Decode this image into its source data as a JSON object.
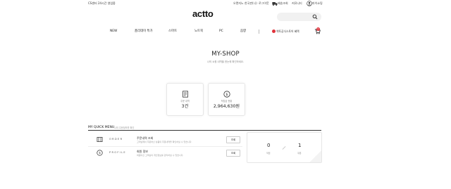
{
  "topbar": {
    "hours_text": "CS센터 24시간 영업중",
    "links": [
      "오렌지노 한국판(나)",
      "로그아웃"
    ],
    "shipping_label": "배송조회",
    "community_label": "커뮤니티",
    "mypage_label": "마이쇼핑"
  },
  "logo": "actto",
  "search": {
    "placeholder": ""
  },
  "nav": {
    "items": [
      "NEW",
      "홈리데이 특가",
      "스마트",
      "노트북",
      "PC",
      "음향"
    ],
    "promo_label": "액토공식스토어 혜택",
    "cart_count": "0"
  },
  "page": {
    "title": "MY-SHOP",
    "subtitle": "나의 쇼핑 내역을 한눈에 확인하세요."
  },
  "cards": [
    {
      "icon": "receipt-icon",
      "label": "주문 내역",
      "value": "3건"
    },
    {
      "icon": "coin-icon",
      "label": "적립금 현황",
      "value": "2,964,630원"
    }
  ],
  "quick_menu": {
    "title": "MY QUICK MENU",
    "note": "나의 주문정보를 확인",
    "rows": [
      {
        "icon": "box-icon",
        "label": "ORDER",
        "title": "주문내역 조회",
        "desc": "고객님께서 주문하신 상품의 주문내역을 확인하실 수 있습니다.",
        "button": "조회"
      },
      {
        "icon": "coin-icon",
        "label": "PROFILE",
        "title": "회원 정보",
        "desc": "회원이신 고객님의 개인정보를 관리하실 수 있습니다.",
        "button": "조회"
      }
    ]
  },
  "stats": [
    {
      "value": "0",
      "label": "적립"
    },
    {
      "value": "1",
      "label": "쿠폰"
    }
  ]
}
